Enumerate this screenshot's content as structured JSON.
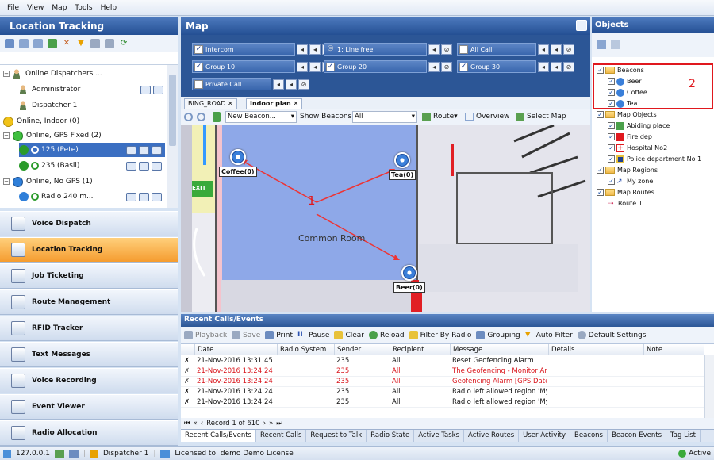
{
  "menu": [
    "File",
    "View",
    "Map",
    "Tools",
    "Help"
  ],
  "left_panel": {
    "title": "Location Tracking",
    "tree": [
      {
        "label": "Online Dispatchers ...",
        "kind": "group"
      },
      {
        "label": "Administrator",
        "kind": "dispatcher"
      },
      {
        "label": "Dispatcher 1",
        "kind": "dispatcher"
      },
      {
        "label": "Online, Indoor (0)",
        "kind": "status",
        "color": "#f2c318"
      },
      {
        "label": "Online, GPS Fixed (2)",
        "kind": "status",
        "color": "#3fbf3f"
      },
      {
        "label": "125 (Pete)",
        "kind": "radio",
        "selected": true
      },
      {
        "label": "235 (Basil)",
        "kind": "radio"
      },
      {
        "label": "Online, No GPS (1)",
        "kind": "status",
        "color": "#2f7fd9"
      },
      {
        "label": "Radio 240 m...",
        "kind": "radio"
      }
    ],
    "nav": [
      {
        "label": "Voice Dispatch",
        "active": false
      },
      {
        "label": "Location Tracking",
        "active": true
      },
      {
        "label": "Job Ticketing",
        "active": false
      },
      {
        "label": "Route Management",
        "active": false
      },
      {
        "label": "RFID Tracker",
        "active": false
      },
      {
        "label": "Text Messages",
        "active": false
      },
      {
        "label": "Voice Recording",
        "active": false
      },
      {
        "label": "Event Viewer",
        "active": false
      },
      {
        "label": "Radio Allocation",
        "active": false
      }
    ]
  },
  "map": {
    "title": "Map",
    "groups": [
      {
        "label": "Intercom",
        "checked": true
      },
      {
        "label": "1: Line free",
        "checked": false,
        "status": true
      },
      {
        "label": "All Call",
        "checked": false
      },
      {
        "label": "Group 10",
        "checked": true
      },
      {
        "label": "Group 20",
        "checked": true
      },
      {
        "label": "Group 30",
        "checked": true
      },
      {
        "label": "Private Call",
        "checked": false
      }
    ],
    "tabs": [
      "BING_ROAD",
      "Indoor plan"
    ],
    "tools": {
      "new_beacon": "New Beacon...",
      "show_beacons_label": "Show Beacons:",
      "show_beacons_value": "All",
      "route": "Route",
      "overview": "Overview",
      "select_map": "Select Map"
    },
    "beacons": [
      "Coffee(0)",
      "Tea(0)",
      "Beer(0)"
    ],
    "room_label": "Common Room",
    "exit_label": "EXIT",
    "annotation": "1"
  },
  "objects": {
    "title": "Objects",
    "annotation": "2",
    "tree": [
      {
        "label": "Beacons",
        "level": 0,
        "type": "folder"
      },
      {
        "label": "Beer",
        "level": 1,
        "type": "beacon"
      },
      {
        "label": "Coffee",
        "level": 1,
        "type": "beacon"
      },
      {
        "label": "Tea",
        "level": 1,
        "type": "beacon"
      },
      {
        "label": "Map Objects",
        "level": 0,
        "type": "folder"
      },
      {
        "label": "Abiding place",
        "level": 1,
        "type": "place"
      },
      {
        "label": "Fire dep",
        "level": 1,
        "type": "fire"
      },
      {
        "label": "Hospital No2",
        "level": 1,
        "type": "hospital"
      },
      {
        "label": "Police department No 1",
        "level": 1,
        "type": "police"
      },
      {
        "label": "Map Regions",
        "level": 0,
        "type": "folder"
      },
      {
        "label": "My zone",
        "level": 1,
        "type": "region"
      },
      {
        "label": "Map Routes",
        "level": 0,
        "type": "folder"
      },
      {
        "label": "Route 1",
        "level": 1,
        "type": "route"
      }
    ]
  },
  "recent": {
    "title": "Recent Calls/Events",
    "toolbar": [
      "Playback",
      "Save",
      "Print",
      "Pause",
      "Clear",
      "Reload",
      "Filter By Radio",
      "Grouping",
      "Auto Filter",
      "Default Settings"
    ],
    "columns": [
      "Date",
      "Radio System",
      "Sender",
      "Recipient",
      "Message",
      "Details",
      "Note"
    ],
    "rows": [
      {
        "date": "21-Nov-2016 13:31:45",
        "sender": "235",
        "recipient": "All",
        "message": "Reset Geofencing Alarm",
        "red": false
      },
      {
        "date": "21-Nov-2016 13:24:24",
        "sender": "235",
        "recipient": "All",
        "message": "The Geofencing - Monitor Ar...",
        "red": true
      },
      {
        "date": "21-Nov-2016 13:24:24",
        "sender": "235",
        "recipient": "All",
        "message": "Geofencing Alarm [GPS Date...",
        "red": true
      },
      {
        "date": "21-Nov-2016 13:24:24",
        "sender": "235",
        "recipient": "All",
        "message": "Radio left allowed region 'My...",
        "red": false
      },
      {
        "date": "21-Nov-2016 13:24:24",
        "sender": "235",
        "recipient": "All",
        "message": "Radio left allowed region 'My...",
        "red": false
      }
    ],
    "record": "Record 1 of 610",
    "tabs": [
      "Recent Calls/Events",
      "Recent Calls",
      "Request to Talk",
      "Radio State",
      "Active Tasks",
      "Active Routes",
      "User Activity",
      "Beacons",
      "Beacon Events",
      "Tag List"
    ]
  },
  "status": {
    "ip": "127.0.0.1",
    "user": "Dispatcher 1",
    "license": "Licensed to: demo Demo License",
    "state": "Active"
  },
  "colors": {
    "accent": "#2c5696",
    "active_nav": "#f59c2f",
    "alert": "#d9141b",
    "annotation": "#e0181e"
  }
}
